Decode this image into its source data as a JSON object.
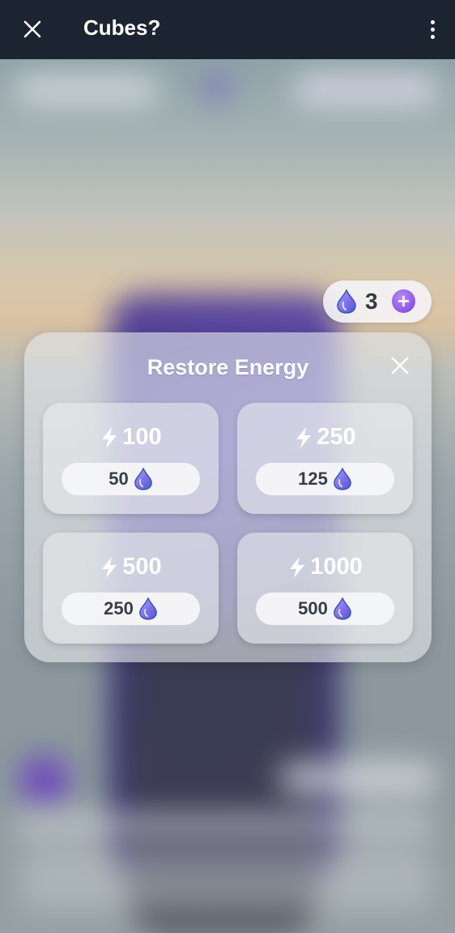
{
  "app_bar": {
    "title": "Cubes?",
    "close_icon": "close-icon",
    "menu_icon": "more-vert-icon"
  },
  "currency": {
    "icon": "gem-drop-icon",
    "count": "3",
    "add_icon": "plus-icon"
  },
  "modal": {
    "title": "Restore Energy",
    "close_icon": "close-icon",
    "options": [
      {
        "energy": "100",
        "cost": "50"
      },
      {
        "energy": "250",
        "cost": "125"
      },
      {
        "energy": "500",
        "cost": "250"
      },
      {
        "energy": "1000",
        "cost": "500"
      }
    ]
  },
  "colors": {
    "app_bar_bg": "#1c2431",
    "accent_purple": "#8b56e6",
    "gem_blue": "#5b7fe0"
  }
}
